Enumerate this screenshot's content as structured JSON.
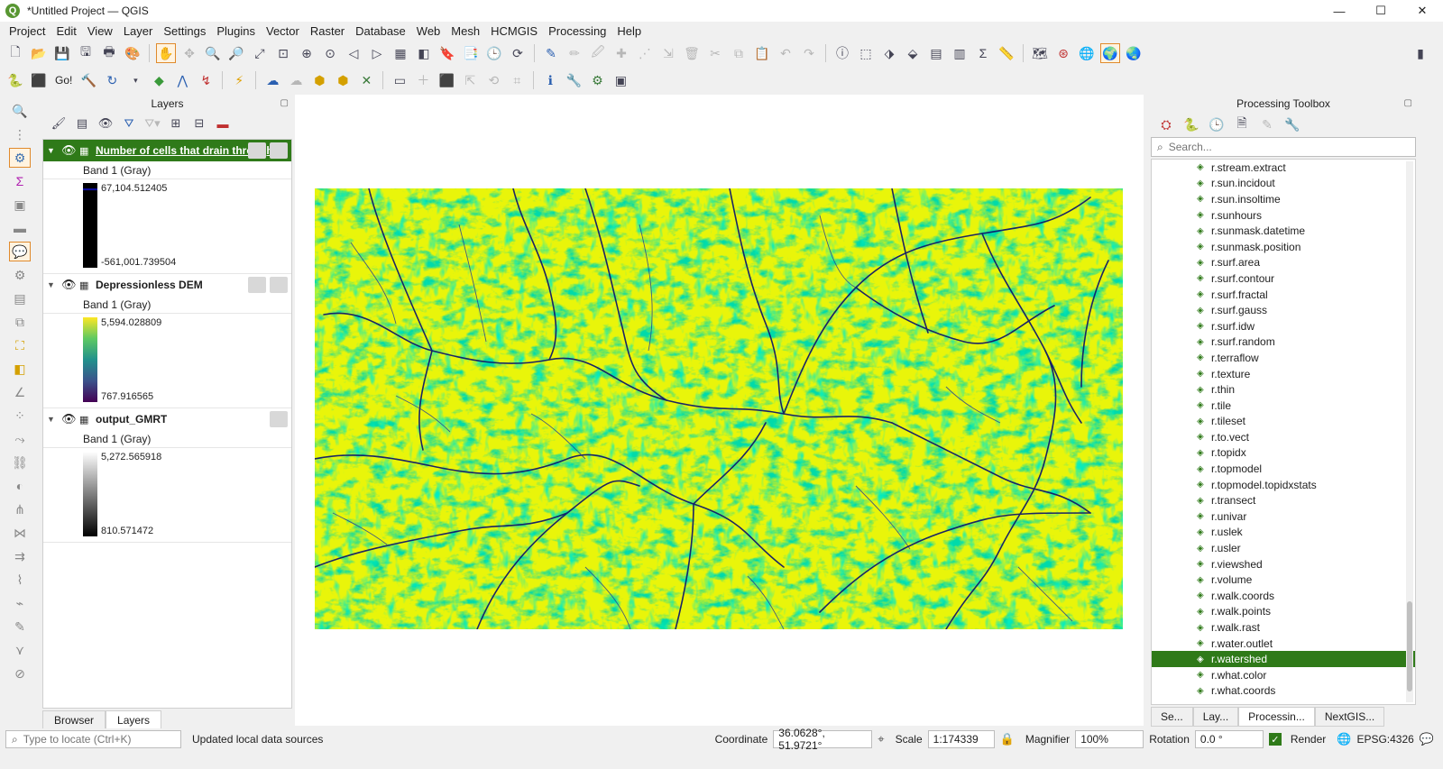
{
  "window": {
    "title": "*Untitled Project — QGIS",
    "logo": "Q",
    "controls": [
      "—",
      "☐",
      "✕"
    ]
  },
  "menubar": [
    "Project",
    "Edit",
    "View",
    "Layer",
    "Settings",
    "Plugins",
    "Vector",
    "Raster",
    "Database",
    "Web",
    "Mesh",
    "HCMGIS",
    "Processing",
    "Help"
  ],
  "toolbar2": {
    "go_label": "Go!"
  },
  "layers_panel": {
    "title": "Layers",
    "layers": [
      {
        "name": "Number of cells that drain through each cell",
        "band": "Band 1 (Gray)",
        "max": "67,104.512405",
        "min": "-561,001.739504",
        "ramp": "black-blue",
        "selected": true
      },
      {
        "name": "Depressionless DEM",
        "band": "Band 1 (Gray)",
        "max": "5,594.028809",
        "min": "767.916565",
        "ramp": "viridis",
        "selected": false
      },
      {
        "name": "output_GMRT",
        "band": "Band 1 (Gray)",
        "max": "5,272.565918",
        "min": "810.571472",
        "ramp": "gray",
        "selected": false
      }
    ],
    "tabs": [
      "Browser",
      "Layers"
    ]
  },
  "processing_toolbox": {
    "title": "Processing Toolbox",
    "search_placeholder": "Search...",
    "algorithms": [
      "r.stream.extract",
      "r.sun.incidout",
      "r.sun.insoltime",
      "r.sunhours",
      "r.sunmask.datetime",
      "r.sunmask.position",
      "r.surf.area",
      "r.surf.contour",
      "r.surf.fractal",
      "r.surf.gauss",
      "r.surf.idw",
      "r.surf.random",
      "r.terraflow",
      "r.texture",
      "r.thin",
      "r.tile",
      "r.tileset",
      "r.to.vect",
      "r.topidx",
      "r.topmodel",
      "r.topmodel.topidxstats",
      "r.transect",
      "r.univar",
      "r.uslek",
      "r.usler",
      "r.viewshed",
      "r.volume",
      "r.walk.coords",
      "r.walk.points",
      "r.walk.rast",
      "r.water.outlet",
      "r.watershed",
      "r.what.color",
      "r.what.coords"
    ],
    "selected": "r.watershed",
    "tabs": [
      "Se...",
      "Lay...",
      "Processin...",
      "NextGIS..."
    ]
  },
  "statusbar": {
    "locate_placeholder": "Type to locate (Ctrl+K)",
    "message": "Updated local data sources",
    "coordinate_label": "Coordinate",
    "coordinate": "36.0628°, 51.9721°",
    "scale_label": "Scale",
    "scale": "1:174339",
    "magnifier_label": "Magnifier",
    "magnifier": "100%",
    "rotation_label": "Rotation",
    "rotation": "0.0 °",
    "render_label": "Render",
    "crs": "EPSG:4326"
  }
}
